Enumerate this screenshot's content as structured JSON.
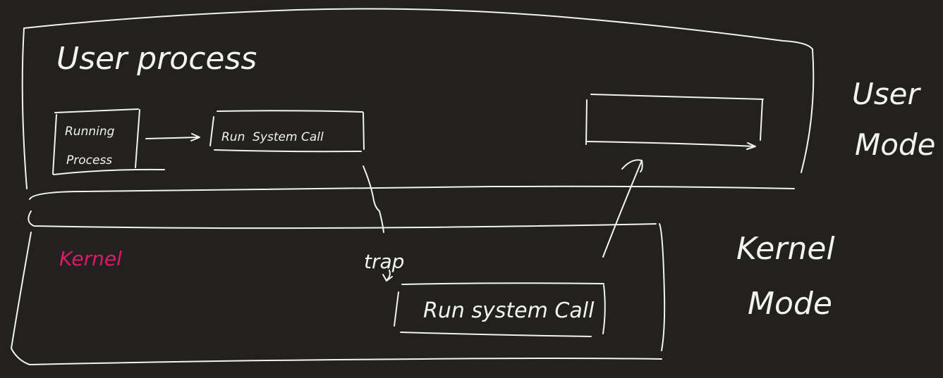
{
  "colors": {
    "background": "#222120",
    "ink": "#f2f2f0",
    "accent": "#e0186b"
  },
  "user_region": {
    "title": "User process",
    "running_process": {
      "line1": "Running",
      "line2": "Process"
    },
    "run_system_call_small": "Run  System Call",
    "return_box_label": ""
  },
  "kernel_region": {
    "label": "Kernel",
    "trap_label": "trap",
    "run_system_call_box": "Run system Call"
  },
  "mode_labels": {
    "user_line1": "User",
    "user_line2": "Mode",
    "kernel_line1": "Kernel",
    "kernel_line2": "Mode"
  }
}
